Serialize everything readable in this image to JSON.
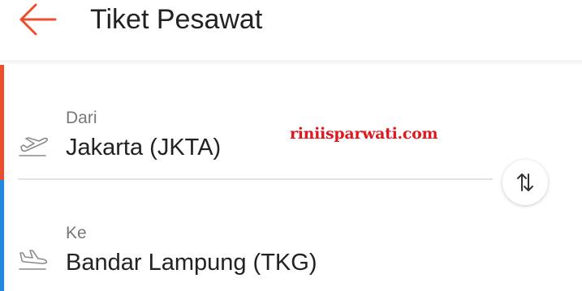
{
  "header": {
    "title": "Tiket Pesawat",
    "back_icon": "arrow-left-icon",
    "back_color": "#ee4d2d"
  },
  "route": {
    "from": {
      "label": "Dari",
      "value": "Jakarta (JKTA)",
      "icon": "takeoff-plane-icon",
      "accent_color": "#ee4d2d"
    },
    "to": {
      "label": "Ke",
      "value": "Bandar Lampung (TKG)",
      "icon": "landing-plane-icon",
      "accent_color": "#1e88e5"
    },
    "swap_icon": "swap-vertical-icon"
  },
  "watermark": "riniisparwati.com"
}
